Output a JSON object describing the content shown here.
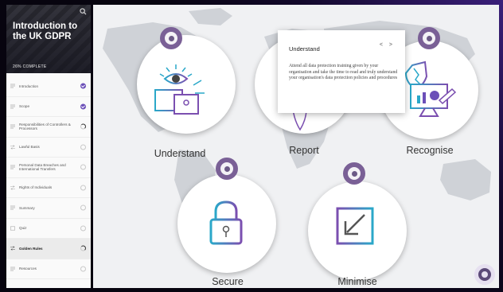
{
  "sidebar": {
    "course_title": "Introduction to the UK GDPR",
    "progress_label": "26% COMPLETE",
    "items": [
      {
        "label": "Introduction",
        "status": "complete"
      },
      {
        "label": "Scope",
        "status": "complete"
      },
      {
        "label": "Responsibilities of Controllers & Processors",
        "status": "in-progress"
      },
      {
        "label": "Lawful Basis",
        "status": "not-started"
      },
      {
        "label": "Personal Data Breaches and International Transfers",
        "status": "not-started"
      },
      {
        "label": "Rights of Individuals",
        "status": "not-started"
      },
      {
        "label": "Summary",
        "status": "not-started"
      },
      {
        "label": "Quiz",
        "status": "not-started"
      },
      {
        "label": "Golden Rules",
        "status": "in-progress",
        "active": true
      },
      {
        "label": "Resources",
        "status": "not-started"
      }
    ]
  },
  "main": {
    "cards": [
      {
        "label": "Understand",
        "icon": "understand-icon"
      },
      {
        "label": "Report",
        "icon": "report-icon"
      },
      {
        "label": "Recognise",
        "icon": "recognise-icon"
      },
      {
        "label": "Secure",
        "icon": "lock-icon"
      },
      {
        "label": "Minimise",
        "icon": "minimise-icon"
      }
    ],
    "popup": {
      "title": "Understand",
      "nav": "< >",
      "body": "Attend all data protection training given by your organisation and take the time to read and truly understand your organisation's data protection policies and procedures"
    }
  },
  "colors": {
    "accent": "#6b4fb8",
    "ring": "#7a6096"
  }
}
